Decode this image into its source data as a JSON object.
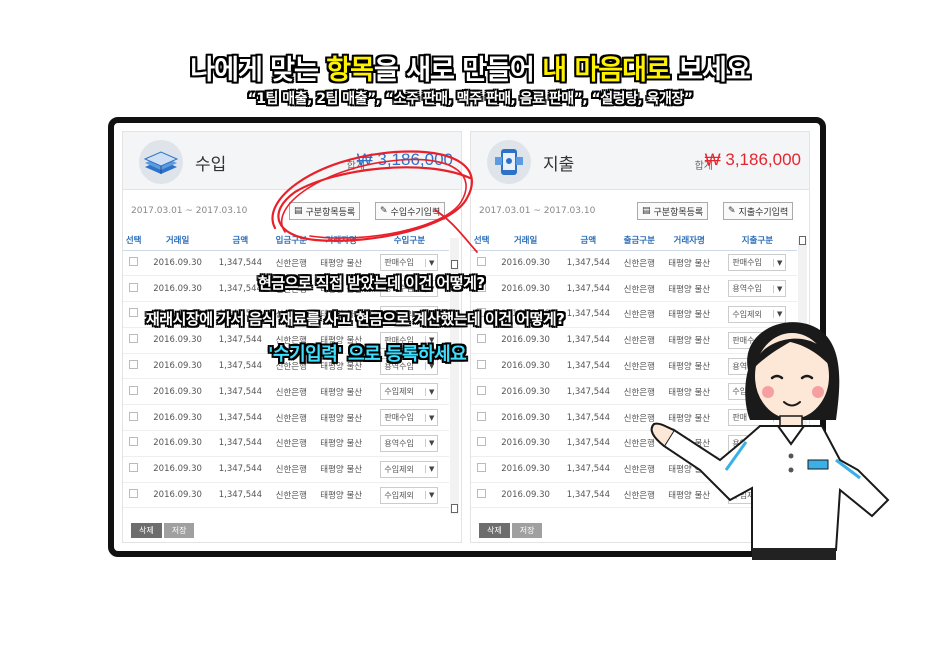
{
  "headline": {
    "part1": "나에게 맞는 ",
    "highlight1": "항목",
    "part2": "을 새로 만들어 ",
    "highlight2": "내 마음대로",
    "part3": " 보세요"
  },
  "subline": "“1팀 매출, 2팀 매출”, “소주 판매, 맥주 판매, 음료 판매”, “설렁탕, 육개장”",
  "income": {
    "title": "수입",
    "total_label": "합계",
    "total_value": "₩ 3,186,000",
    "date_range": "2017.03.01 ~ 2017.03.10",
    "btn_category": "구분항목등록",
    "btn_manual": "수입수기입력",
    "headers": [
      "선택",
      "거래일",
      "금액",
      "입금구분",
      "거래자명",
      "수입구분"
    ],
    "rows": [
      {
        "date": "2016.09.30",
        "amount": "1,347,544",
        "bank": "신한은행",
        "partner": "태평양 물산",
        "category": "판매수입"
      },
      {
        "date": "2016.09.30",
        "amount": "1,347,544",
        "bank": "신한은행",
        "partner": "태평양 물산",
        "category": "용역수입"
      },
      {
        "date": "2016.09.30",
        "amount": "1,347,544",
        "bank": "신한은행",
        "partner": "태평양 물산",
        "category": "수입제외"
      },
      {
        "date": "2016.09.30",
        "amount": "1,347,544",
        "bank": "신한은행",
        "partner": "태평양 물산",
        "category": "판매수입"
      },
      {
        "date": "2016.09.30",
        "amount": "1,347,544",
        "bank": "신한은행",
        "partner": "태평양 물산",
        "category": "용역수입"
      },
      {
        "date": "2016.09.30",
        "amount": "1,347,544",
        "bank": "신한은행",
        "partner": "태평양 물산",
        "category": "수입제외"
      },
      {
        "date": "2016.09.30",
        "amount": "1,347,544",
        "bank": "신한은행",
        "partner": "태평양 물산",
        "category": "판매수입"
      },
      {
        "date": "2016.09.30",
        "amount": "1,347,544",
        "bank": "신한은행",
        "partner": "태평양 물산",
        "category": "용역수입"
      },
      {
        "date": "2016.09.30",
        "amount": "1,347,544",
        "bank": "신한은행",
        "partner": "태평양 물산",
        "category": "수입제외"
      },
      {
        "date": "2016.09.30",
        "amount": "1,347,544",
        "bank": "신한은행",
        "partner": "태평양 물산",
        "category": "수입제외"
      }
    ],
    "btn_delete": "삭제",
    "btn_save": "저장"
  },
  "expense": {
    "title": "지출",
    "total_label": "합계",
    "total_value": "₩ 3,186,000",
    "date_range": "2017.03.01 ~ 2017.03.10",
    "btn_category": "구분항목등록",
    "btn_manual": "지출수기입력",
    "headers": [
      "선택",
      "거래일",
      "금액",
      "출금구분",
      "거래자명",
      "지출구분"
    ],
    "rows": [
      {
        "date": "2016.09.30",
        "amount": "1,347,544",
        "bank": "신한은행",
        "partner": "태평양 물산",
        "category": "판매수입"
      },
      {
        "date": "2016.09.30",
        "amount": "1,347,544",
        "bank": "신한은행",
        "partner": "태평양 물산",
        "category": "용역수입"
      },
      {
        "date": "2016.09.30",
        "amount": "1,347,544",
        "bank": "신한은행",
        "partner": "태평양 물산",
        "category": "수입제외"
      },
      {
        "date": "2016.09.30",
        "amount": "1,347,544",
        "bank": "신한은행",
        "partner": "태평양 물산",
        "category": "판매수"
      },
      {
        "date": "2016.09.30",
        "amount": "1,347,544",
        "bank": "신한은행",
        "partner": "태평양 물산",
        "category": "용역"
      },
      {
        "date": "2016.09.30",
        "amount": "1,347,544",
        "bank": "신한은행",
        "partner": "태평양 물산",
        "category": "수입"
      },
      {
        "date": "2016.09.30",
        "amount": "1,347,544",
        "bank": "신한은행",
        "partner": "태평양 물산",
        "category": "판매"
      },
      {
        "date": "2016.09.30",
        "amount": "1,347,544",
        "bank": "신한은행",
        "partner": "태평양 물산",
        "category": "용역"
      },
      {
        "date": "2016.09.30",
        "amount": "1,347,544",
        "bank": "신한은행",
        "partner": "태평양 물산",
        "category": "수입"
      },
      {
        "date": "2016.09.30",
        "amount": "1,347,544",
        "bank": "신한은행",
        "partner": "태평양 물산",
        "category": "수입제"
      }
    ],
    "btn_delete": "삭제",
    "btn_save": "저장"
  },
  "callouts": {
    "line1": "현금으로 직접 받았는데 이건 어떻게?",
    "line2": "재래시장에 가서 음식 재료를 사고 현금으로 계산했는데 이건 어떻게?",
    "line3": "'수기입력' 으로 등록하세요"
  },
  "colors": {
    "income_total": "#2e72c8",
    "expense_total": "#e4262f",
    "annotation_circle": "#e8202a",
    "callout_highlight": "#3fe0ff",
    "headline_highlight": "#fff200"
  }
}
